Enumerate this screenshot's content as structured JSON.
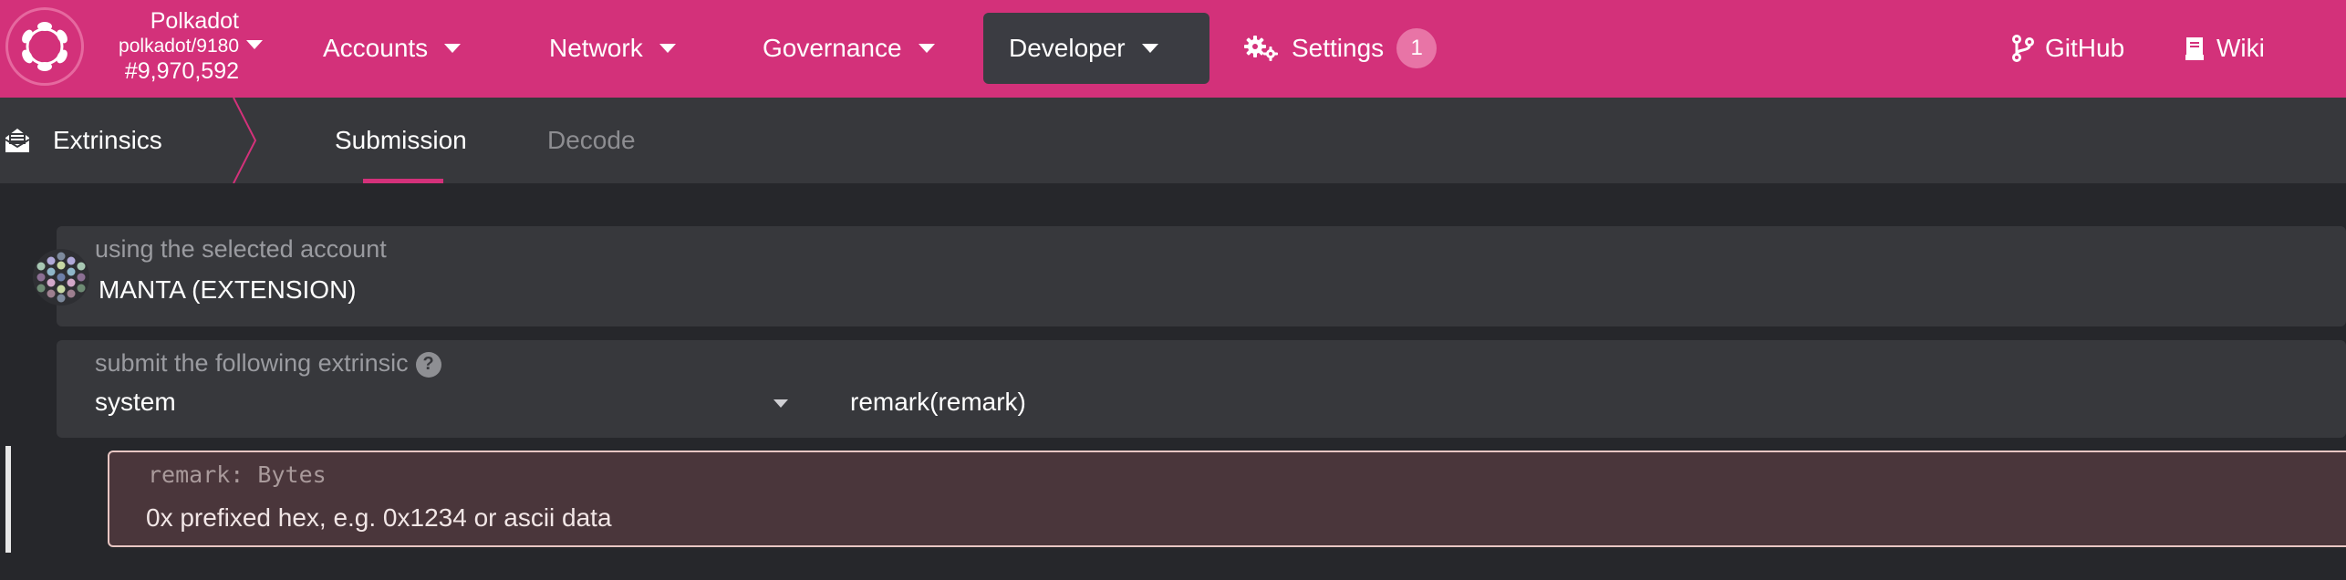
{
  "topbar": {
    "chain_name": "Polkadot",
    "chain_spec": "polkadot/9180",
    "block_number": "#9,970,592",
    "nav": {
      "accounts": "Accounts",
      "network": "Network",
      "governance": "Governance",
      "developer": "Developer",
      "settings": "Settings",
      "settings_badge": "1",
      "github": "GitHub",
      "wiki": "Wiki"
    },
    "accent_color": "#d3317a"
  },
  "subheader": {
    "section": "Extrinsics",
    "tabs": [
      {
        "label": "Submission",
        "active": true
      },
      {
        "label": "Decode",
        "active": false
      }
    ]
  },
  "account": {
    "label": "using the selected account",
    "value": "MANTA (EXTENSION)"
  },
  "extrinsic": {
    "label": "submit the following extrinsic",
    "module": "system",
    "call": "remark(remark)"
  },
  "param": {
    "type_label": "remark: Bytes",
    "placeholder": "0x prefixed hex, e.g. 0x1234 or ascii data",
    "value": ""
  }
}
